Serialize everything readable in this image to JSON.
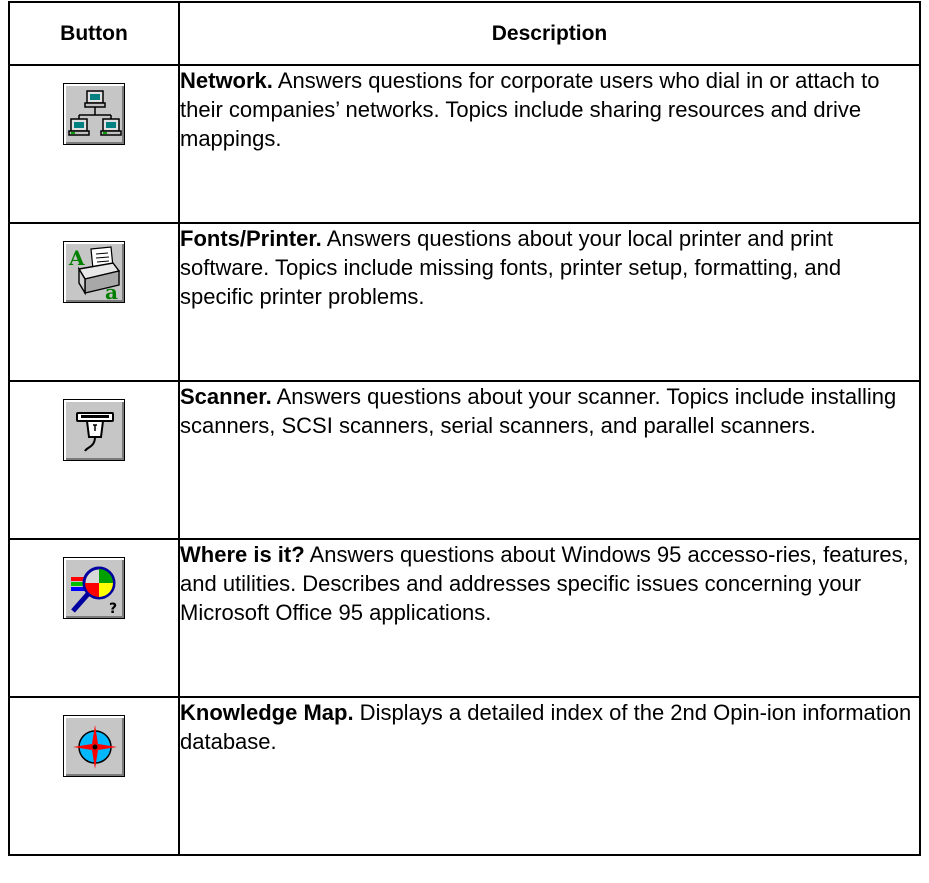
{
  "header": {
    "button_col": "Button",
    "description_col": "Description"
  },
  "rows": [
    {
      "icon": "network-icon",
      "title": "Network.",
      "text": " Answers questions for corporate users who dial in or attach to their companies’ networks. Topics include sharing resources and drive mappings."
    },
    {
      "icon": "fonts-printer-icon",
      "title": "Fonts/Printer.",
      "text": " Answers questions about your local printer and print software. Topics include missing fonts, printer setup, formatting, and specific printer problems."
    },
    {
      "icon": "scanner-icon",
      "title": "Scanner.",
      "text": " Answers questions about your scanner. Topics include installing scanners, SCSI scanners, serial scanners, and parallel scanners."
    },
    {
      "icon": "where-is-it-icon",
      "title": "Where is it?",
      "text": " Answers questions about Windows 95 accesso-ries, features, and utilities. Describes and addresses specific issues concerning your Microsoft Office 95 applications."
    },
    {
      "icon": "knowledge-map-icon",
      "title": "Knowledge Map.",
      "text": " Displays a detailed index of the 2nd Opin-ion information database."
    }
  ],
  "colors": {
    "button_face": "#c6c6c6",
    "border": "#000000"
  }
}
